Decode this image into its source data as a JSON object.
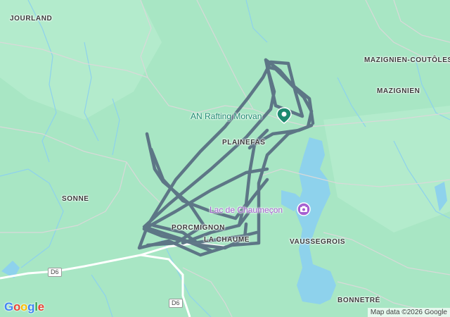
{
  "map": {
    "places": [
      {
        "id": "jourland",
        "label": "JOURLAND"
      },
      {
        "id": "mazignien-coutoles",
        "label": "MAZIGNIEN-COUTÔLES"
      },
      {
        "id": "mazignien",
        "label": "MAZIGNIEN"
      },
      {
        "id": "plainefas",
        "label": "PLAINEFAS"
      },
      {
        "id": "sonne",
        "label": "SONNE"
      },
      {
        "id": "porcmignon",
        "label": "PORCMIGNON"
      },
      {
        "id": "la-chaume",
        "label": "LA CHAUME"
      },
      {
        "id": "vaussegrois",
        "label": "VAUSSEGROIS"
      },
      {
        "id": "bonnetre",
        "label": "BONNETRÉ"
      }
    ],
    "pois": [
      {
        "id": "rafting",
        "label": "AN Rafting Morvan",
        "icon": "map-pin-icon",
        "color": "#1e8a70"
      },
      {
        "id": "lake",
        "label": "Lac de Chaumeçon",
        "icon": "camera-icon",
        "color": "#a55fd0"
      }
    ],
    "roads": [
      {
        "id": "d6-west",
        "label": "D6"
      },
      {
        "id": "d6-south",
        "label": "D6"
      }
    ],
    "colors": {
      "land": "#a8e6c4",
      "water": "#8ed2ec",
      "road": "#ffffff",
      "route": "#5a7183"
    },
    "logo": "Google",
    "attribution": "Map data ©2026 Google"
  }
}
